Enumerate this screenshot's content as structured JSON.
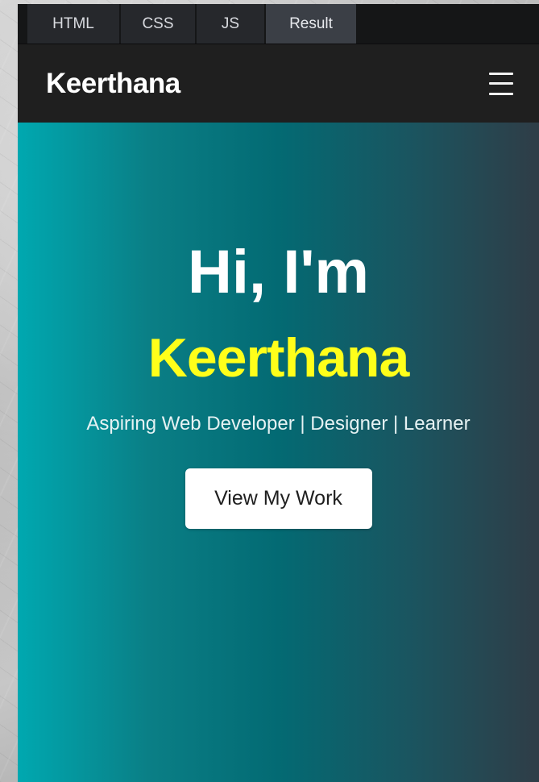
{
  "editor": {
    "tabs": [
      {
        "label": "HTML",
        "active": false
      },
      {
        "label": "CSS",
        "active": false
      },
      {
        "label": "JS",
        "active": false
      },
      {
        "label": "Result",
        "active": true
      }
    ]
  },
  "navbar": {
    "brand": "Keerthana",
    "menu_icon": "hamburger-menu-icon"
  },
  "hero": {
    "greeting": "Hi, I'm",
    "name": "Keerthana",
    "tagline": "Aspiring Web Developer | Designer | Learner",
    "cta_label": "View My Work"
  },
  "colors": {
    "hero_gradient_start": "#00a8b0",
    "hero_gradient_end": "#2f3d47",
    "name_highlight": "#ffff1a",
    "navbar_bg": "#1f1f1f"
  }
}
